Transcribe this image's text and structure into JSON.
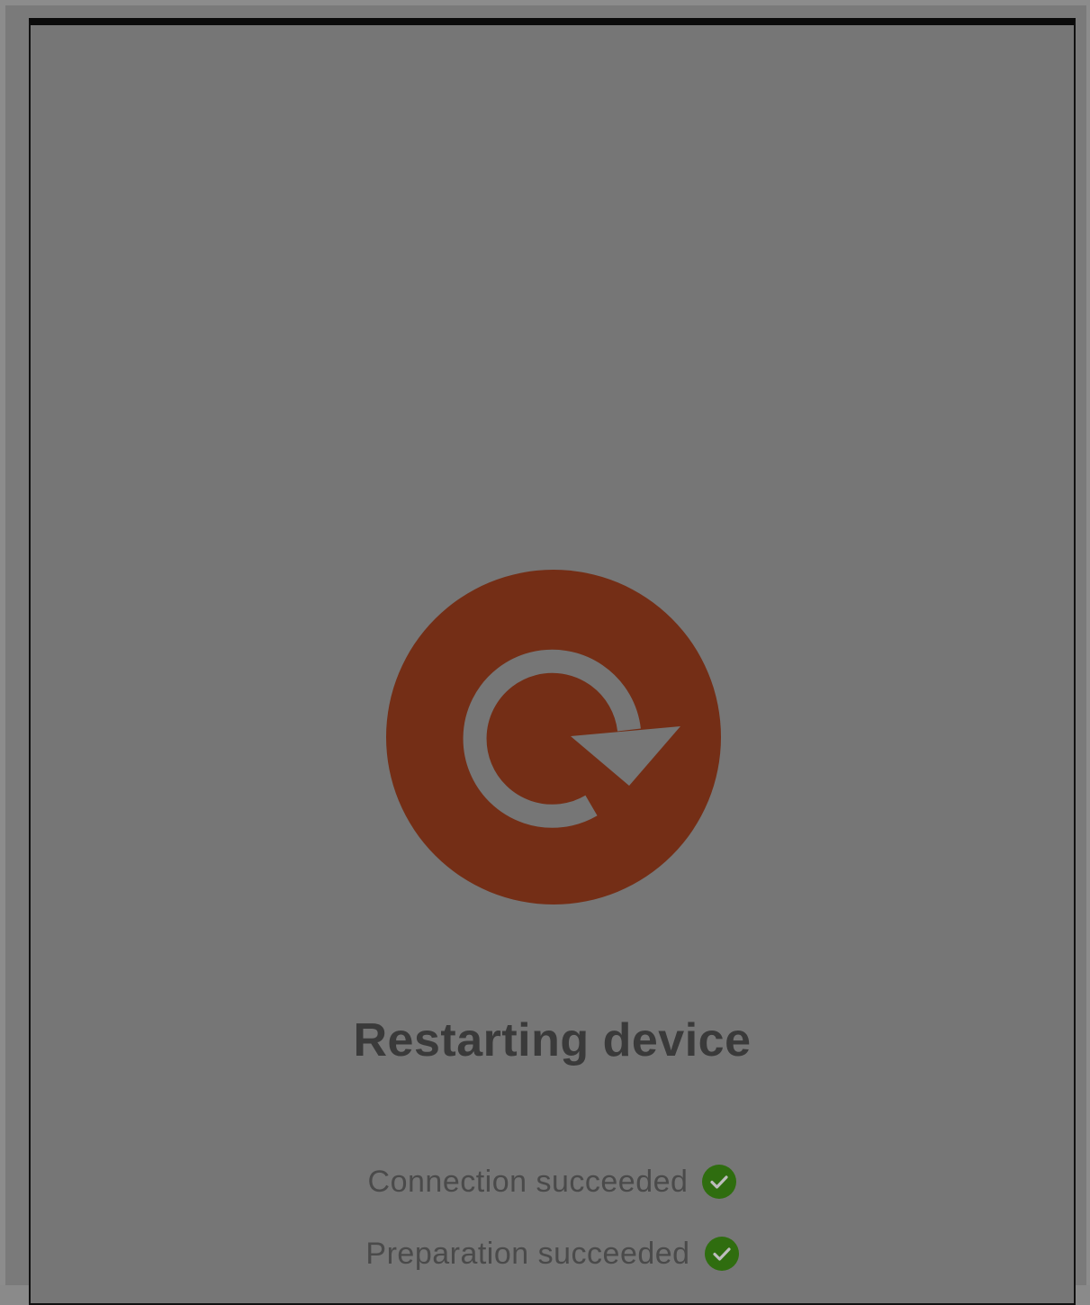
{
  "main": {
    "title": "Restarting device",
    "icon": "restart-icon",
    "statuses": [
      {
        "label": "Connection succeeded",
        "icon": "check-circle-icon",
        "state": "success"
      },
      {
        "label": "Preparation succeeded",
        "icon": "check-circle-icon",
        "state": "success"
      }
    ]
  },
  "colors": {
    "accent": "#742e16",
    "success": "#2f6d0f",
    "overlay": "#767676"
  }
}
